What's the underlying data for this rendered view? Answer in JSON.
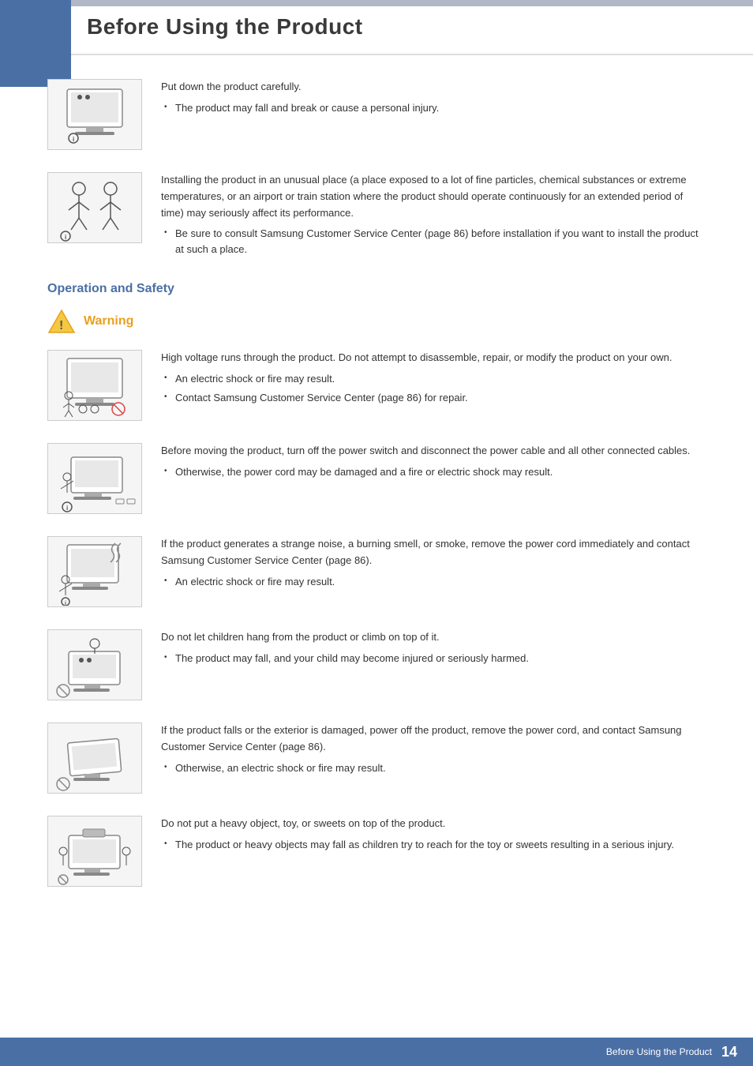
{
  "page": {
    "title": "Before Using the Product",
    "page_number": "14",
    "footer_text": "Before Using the Product"
  },
  "intro_sections": [
    {
      "id": "put-down",
      "main_text": "Put down the product carefully.",
      "bullets": [
        "The product may fall and break or cause a personal injury."
      ]
    },
    {
      "id": "unusual-place",
      "main_text": "Installing the product in an unusual place (a place exposed to a lot of fine particles, chemical substances or extreme temperatures, or an airport or train station where the product should operate continuously for an extended period of time) may seriously affect its performance.",
      "bullets": [
        "Be sure to consult Samsung Customer Service Center (page 86) before installation if you want to install the product at such a place."
      ]
    }
  ],
  "operation_safety": {
    "section_title": "Operation and Safety",
    "warning_label": "Warning",
    "items": [
      {
        "id": "high-voltage",
        "main_text": "High voltage runs through the product. Do not attempt to disassemble, repair, or modify the product on your own.",
        "bullets": [
          "An electric shock or fire may result.",
          "Contact Samsung Customer Service Center (page 86) for repair."
        ]
      },
      {
        "id": "moving-product",
        "main_text": "Before moving the product, turn off the power switch and disconnect the power cable and all other connected cables.",
        "bullets": [
          "Otherwise, the power cord may be damaged and a fire or electric shock may result."
        ]
      },
      {
        "id": "strange-noise",
        "main_text": "If the product generates a strange noise, a burning smell, or smoke, remove the power cord immediately and contact Samsung Customer Service Center (page 86).",
        "bullets": [
          "An electric shock or fire may result."
        ]
      },
      {
        "id": "children-hang",
        "main_text": "Do not let children hang from the product or climb on top of it.",
        "bullets": [
          "The product may fall, and your child may become injured or seriously harmed."
        ]
      },
      {
        "id": "product-falls",
        "main_text": "If the product falls or the exterior is damaged, power off the product, remove the power cord, and contact Samsung Customer Service Center (page 86).",
        "bullets": [
          "Otherwise, an electric shock or fire may result."
        ]
      },
      {
        "id": "heavy-object",
        "main_text": "Do not put a heavy object, toy, or sweets on top of the product.",
        "bullets": [
          "The product or heavy objects may fall as children try to reach for the toy or sweets resulting in a serious injury."
        ]
      }
    ]
  },
  "accent": {
    "blue": "#4a6fa5",
    "warning_orange": "#e8a020",
    "light_gray": "#f5f5f5"
  }
}
